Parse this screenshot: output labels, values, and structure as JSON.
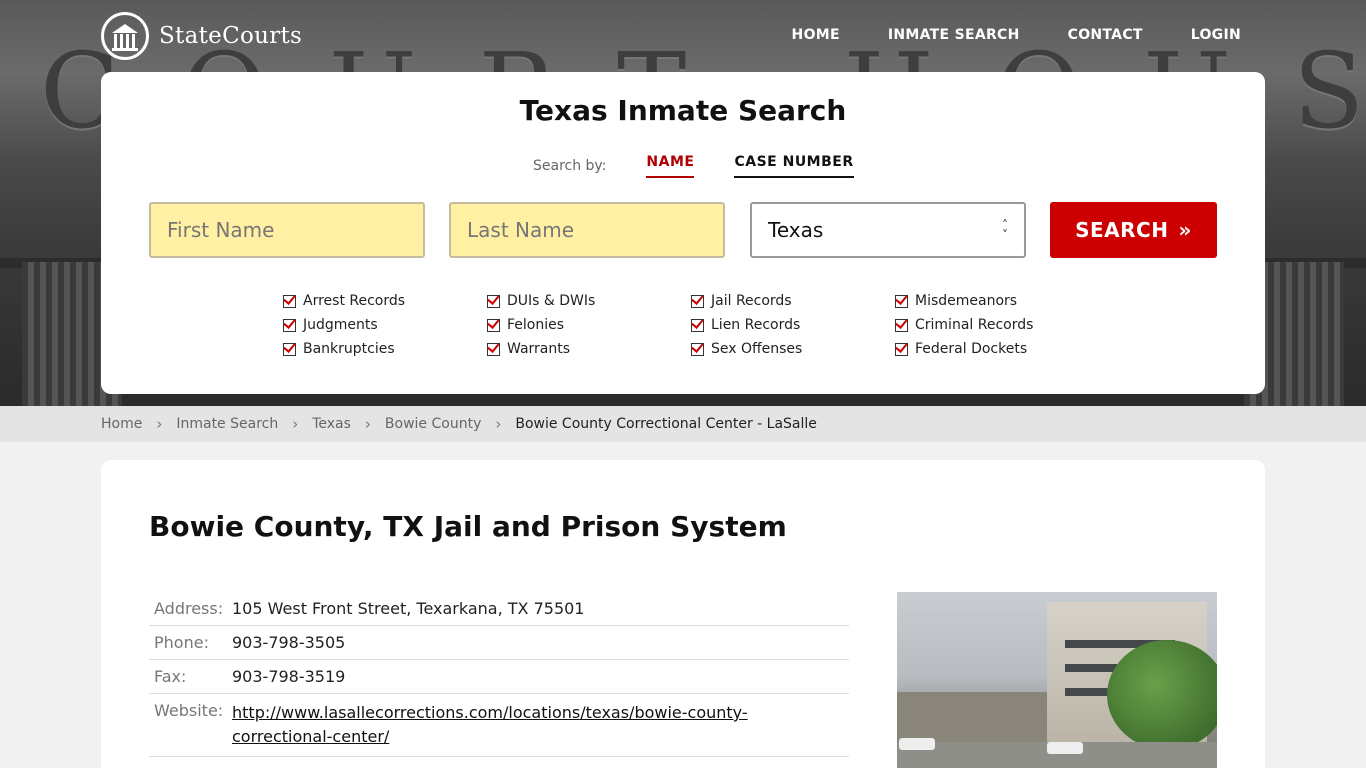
{
  "brand": {
    "name": "StateCourts"
  },
  "nav": [
    "HOME",
    "INMATE SEARCH",
    "CONTACT",
    "LOGIN"
  ],
  "hero": {
    "engraving": "COURT HOUSE"
  },
  "search": {
    "title": "Texas Inmate Search",
    "search_by_label": "Search by:",
    "tabs": [
      "NAME",
      "CASE NUMBER"
    ],
    "first_name_placeholder": "First Name",
    "last_name_placeholder": "Last Name",
    "state_selected": "Texas",
    "button_label": "SEARCH",
    "categories": [
      "Arrest Records",
      "DUIs & DWIs",
      "Jail Records",
      "Misdemeanors",
      "Judgments",
      "Felonies",
      "Lien Records",
      "Criminal Records",
      "Bankruptcies",
      "Warrants",
      "Sex Offenses",
      "Federal Dockets"
    ]
  },
  "breadcrumb": [
    "Home",
    "Inmate Search",
    "Texas",
    "Bowie County",
    "Bowie County Correctional Center - LaSalle"
  ],
  "content": {
    "title": "Bowie County, TX Jail and Prison System",
    "rows": [
      {
        "key": "Address:",
        "value": "105 West Front Street, Texarkana, TX 75501"
      },
      {
        "key": "Phone:",
        "value": "903-798-3505"
      },
      {
        "key": "Fax:",
        "value": "903-798-3519"
      },
      {
        "key": "Website:",
        "value": "http://www.lasallecorrections.com/locations/texas/bowie-county-correctional-center/"
      }
    ]
  }
}
